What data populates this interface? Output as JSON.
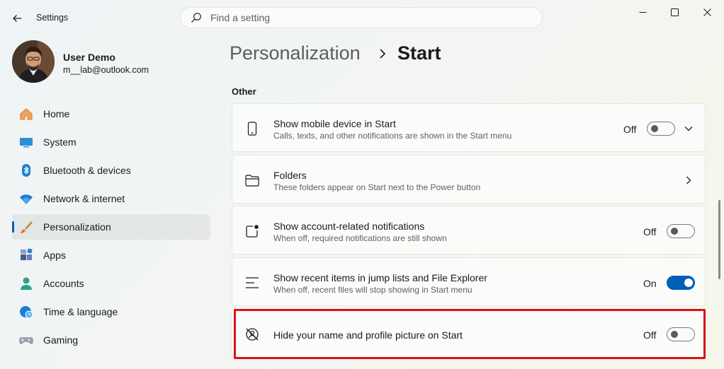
{
  "window": {
    "title": "Settings"
  },
  "search": {
    "placeholder": "Find a setting",
    "value": ""
  },
  "user": {
    "name": "User Demo",
    "email": "m__lab@outlook.com"
  },
  "sidebar": {
    "items": [
      {
        "label": "Home",
        "icon": "home-icon",
        "selected": false
      },
      {
        "label": "System",
        "icon": "system-icon",
        "selected": false
      },
      {
        "label": "Bluetooth & devices",
        "icon": "bluetooth-icon",
        "selected": false
      },
      {
        "label": "Network & internet",
        "icon": "wifi-icon",
        "selected": false
      },
      {
        "label": "Personalization",
        "icon": "brush-icon",
        "selected": true
      },
      {
        "label": "Apps",
        "icon": "apps-icon",
        "selected": false
      },
      {
        "label": "Accounts",
        "icon": "accounts-icon",
        "selected": false
      },
      {
        "label": "Time & language",
        "icon": "clock-globe-icon",
        "selected": false
      },
      {
        "label": "Gaming",
        "icon": "gamepad-icon",
        "selected": false
      }
    ]
  },
  "header": {
    "parent": "Personalization",
    "current": "Start"
  },
  "section": {
    "title": "Other"
  },
  "settings": [
    {
      "title": "Show mobile device in Start",
      "description": "Calls, texts, and other notifications are shown in the Start menu",
      "state": "Off",
      "on": false,
      "icon": "phone-icon",
      "control": "toggle-expand"
    },
    {
      "title": "Folders",
      "description": "These folders appear on Start next to the Power button",
      "icon": "folder-icon",
      "control": "navigate"
    },
    {
      "title": "Show account-related notifications",
      "description": "When off, required notifications are still shown",
      "state": "Off",
      "on": false,
      "icon": "notification-icon",
      "control": "toggle"
    },
    {
      "title": "Show recent items in jump lists and File Explorer",
      "description": "When off, recent files will stop showing in Start menu",
      "state": "On",
      "on": true,
      "icon": "list-icon",
      "control": "toggle"
    },
    {
      "title": "Hide your name and profile picture on Start",
      "state": "Off",
      "on": false,
      "icon": "hide-profile-icon",
      "control": "toggle",
      "highlighted": true
    }
  ],
  "colors": {
    "accent": "#005fb8",
    "highlight_border": "#d7141a"
  }
}
